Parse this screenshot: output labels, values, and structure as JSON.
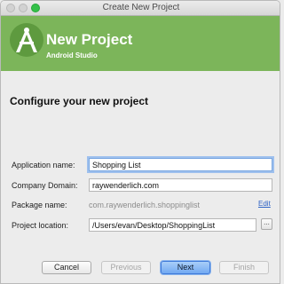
{
  "window": {
    "title": "Create New Project"
  },
  "banner": {
    "title": "New Project",
    "subtitle": "Android Studio",
    "bg_color": "#7cb55a"
  },
  "section_title": "Configure your new project",
  "form": {
    "application_name": {
      "label": "Application name:",
      "value": "Shopping List"
    },
    "company_domain": {
      "label": "Company Domain:",
      "value": "raywenderlich.com"
    },
    "package_name": {
      "label": "Package name:",
      "value": "com.raywenderlich.shoppinglist",
      "edit_label": "Edit"
    },
    "project_location": {
      "label": "Project location:",
      "value": "/Users/evan/Desktop/ShoppingList",
      "browse_label": "..."
    }
  },
  "buttons": {
    "cancel": "Cancel",
    "previous": "Previous",
    "next": "Next",
    "finish": "Finish"
  },
  "icons": {
    "logo": "android-studio-logo-icon",
    "browse": "ellipsis-icon"
  }
}
